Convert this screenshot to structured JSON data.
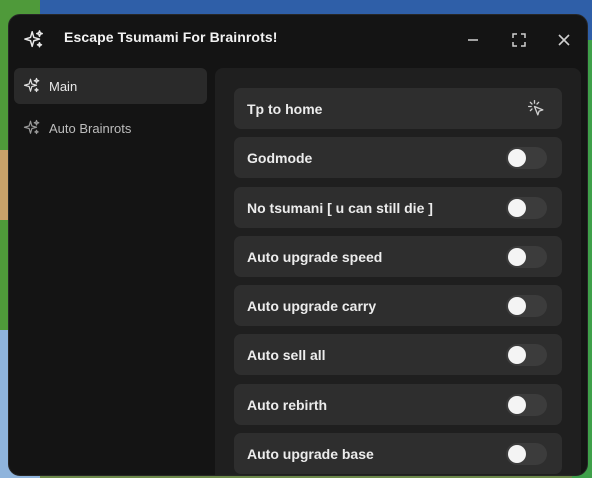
{
  "window": {
    "title": "Escape Tsumami For Brainrots!",
    "icon": "sparkles-icon",
    "controls": [
      "minimize-icon",
      "maximize-icon",
      "close-icon"
    ]
  },
  "sidebar": {
    "items": [
      {
        "label": "Main",
        "icon": "sparkles-icon",
        "active": true
      },
      {
        "label": "Auto Brainrots",
        "icon": "sparkles-icon",
        "active": false
      }
    ]
  },
  "main": {
    "button": {
      "label": "Tp to home",
      "icon": "tap-icon"
    },
    "toggles": [
      {
        "label": "Godmode",
        "on": false
      },
      {
        "label": "No tsumani [ u can still die ]",
        "on": false
      },
      {
        "label": "Auto upgrade speed",
        "on": false
      },
      {
        "label": "Auto upgrade carry",
        "on": false
      },
      {
        "label": "Auto sell all",
        "on": false
      },
      {
        "label": "Auto rebirth",
        "on": false
      },
      {
        "label": "Auto upgrade base",
        "on": false
      }
    ]
  },
  "colors": {
    "window_bg": "#141414",
    "panel_bg": "#1f1f1f",
    "row_bg": "#2e2e2e",
    "toggle_off": "#3c3c3c",
    "knob": "#f4f4f4"
  }
}
